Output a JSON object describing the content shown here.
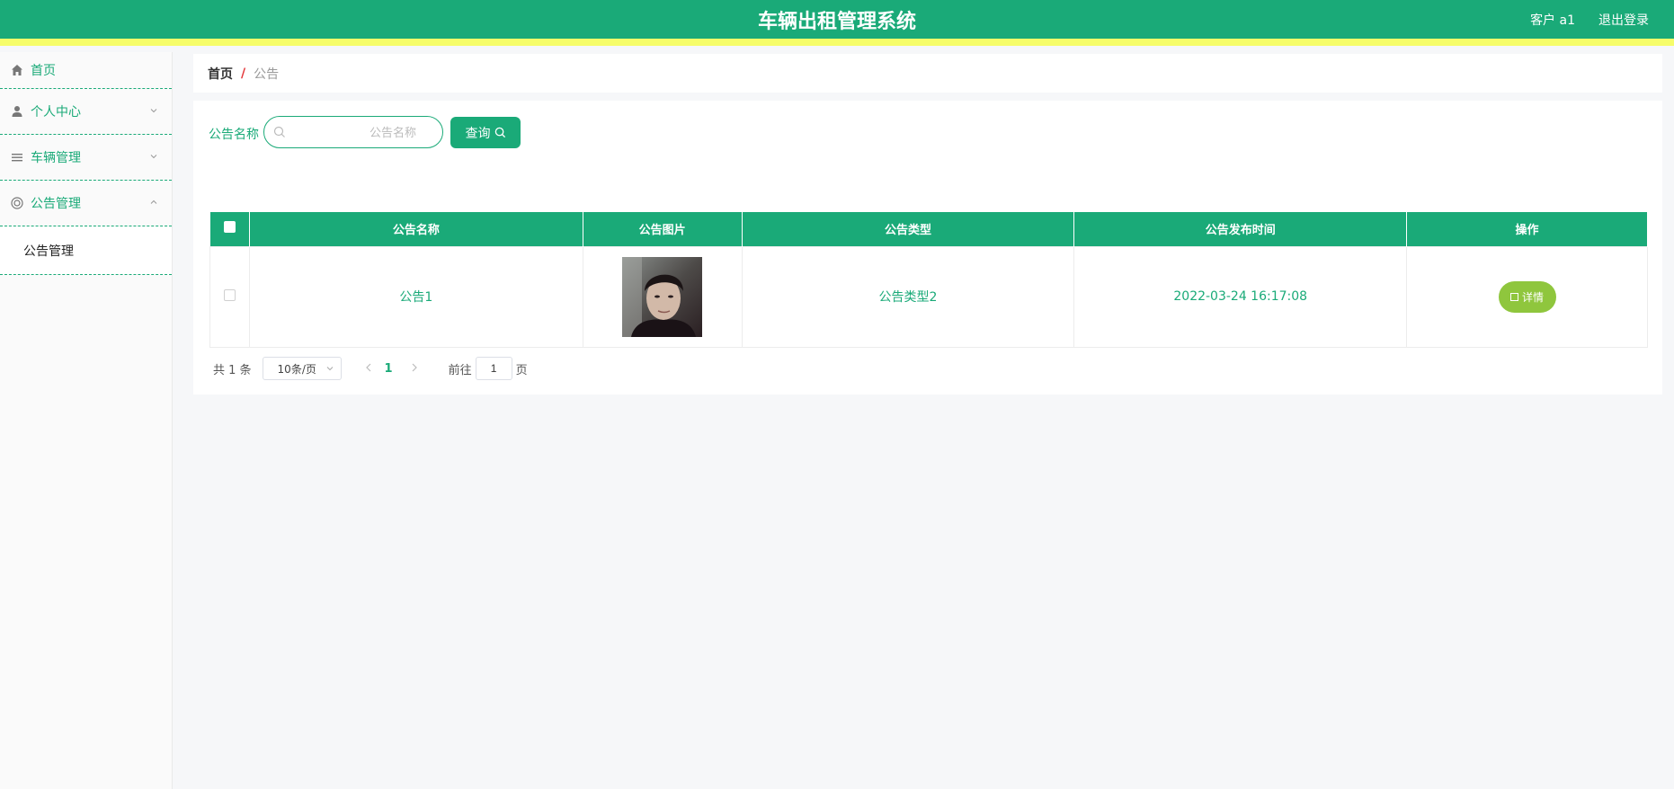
{
  "header": {
    "title": "车辆出租管理系统",
    "user": "客户 a1",
    "logout": "退出登录"
  },
  "sidebar": {
    "home": "首页",
    "items": [
      {
        "label": "个人中心",
        "icon": "user-icon"
      },
      {
        "label": "车辆管理",
        "icon": "list-icon"
      },
      {
        "label": "公告管理",
        "icon": "target-icon"
      }
    ],
    "sub_item": "公告管理"
  },
  "breadcrumb": {
    "home": "首页",
    "separator": "/",
    "current": "公告"
  },
  "search": {
    "label": "公告名称",
    "placeholder": "公告名称",
    "button": "查询"
  },
  "table": {
    "headers": [
      "公告名称",
      "公告图片",
      "公告类型",
      "公告发布时间",
      "操作"
    ],
    "rows": [
      {
        "name": "公告1",
        "type": "公告类型2",
        "time": "2022-03-24 16:17:08",
        "action": "详情"
      }
    ]
  },
  "pagination": {
    "total": "共 1 条",
    "page_size": "10条/页",
    "current_page": "1",
    "goto_label": "前往",
    "goto_value": "1",
    "page_suffix": "页"
  },
  "colors": {
    "primary": "#1aaa78",
    "accent_bar": "#f6fd6a",
    "detail_button": "#8fc63d"
  }
}
